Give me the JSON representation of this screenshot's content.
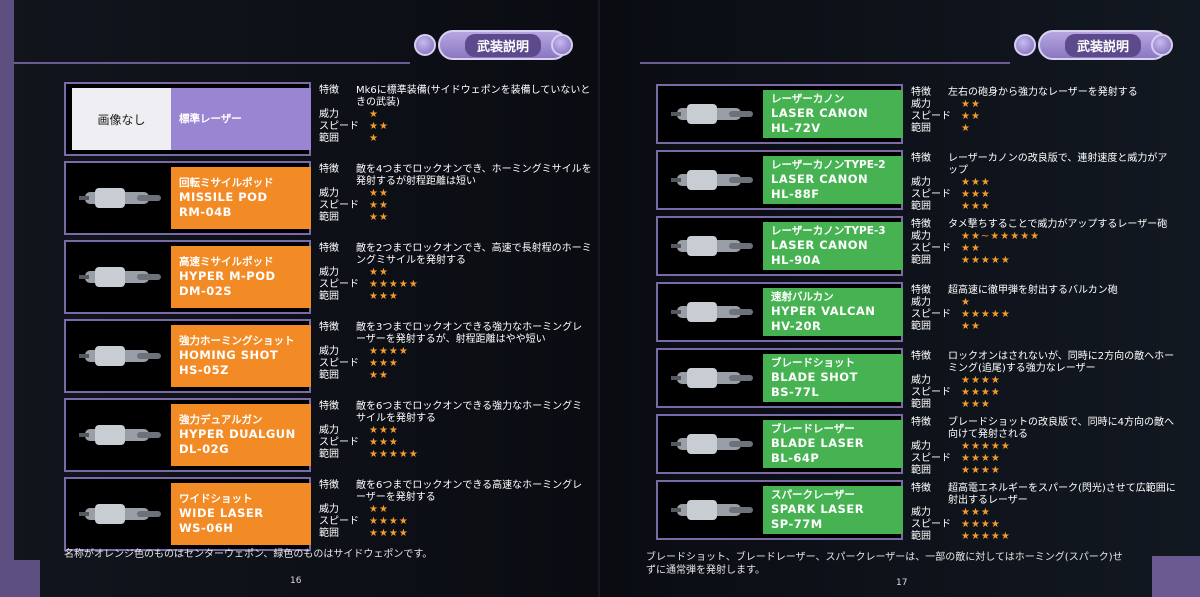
{
  "left": {
    "header": "武装説明",
    "rows": [
      {
        "image": "画像なし",
        "name_jp": "標準レーザー",
        "name_en": "",
        "code": "",
        "color": "purple",
        "feat_label": "特徴",
        "feature": "Mk6に標準装備(サイドウェポンを装備していないときの武装)",
        "stats": [
          {
            "label": "威力",
            "stars": "★"
          },
          {
            "label": "スピード",
            "stars": "★★"
          },
          {
            "label": "範囲",
            "stars": "★"
          }
        ]
      },
      {
        "image": "",
        "name_jp": "回転ミサイルポッド",
        "name_en": "MISSILE POD",
        "code": "RM-04B",
        "color": "orange",
        "feat_label": "特徴",
        "feature": "敵を4つまでロックオンでき、ホーミングミサイルを発射するが射程距離は短い",
        "stats": [
          {
            "label": "威力",
            "stars": "★★"
          },
          {
            "label": "スピード",
            "stars": "★★"
          },
          {
            "label": "範囲",
            "stars": "★★"
          }
        ]
      },
      {
        "image": "",
        "name_jp": "高速ミサイルポッド",
        "name_en": "HYPER M-POD",
        "code": "DM-02S",
        "color": "orange",
        "feat_label": "特徴",
        "feature": "敵を2つまでロックオンでき、高速で長射程のホーミングミサイルを発射する",
        "stats": [
          {
            "label": "威力",
            "stars": "★★"
          },
          {
            "label": "スピード",
            "stars": "★★★★★"
          },
          {
            "label": "範囲",
            "stars": "★★★"
          }
        ]
      },
      {
        "image": "",
        "name_jp": "強力ホーミングショット",
        "name_en": "HOMING SHOT",
        "code": "HS-05Z",
        "color": "orange",
        "feat_label": "特徴",
        "feature": "敵を3つまでロックオンできる強力なホーミングレーザーを発射するが、射程距離はやや短い",
        "stats": [
          {
            "label": "威力",
            "stars": "★★★★"
          },
          {
            "label": "スピード",
            "stars": "★★★"
          },
          {
            "label": "範囲",
            "stars": "★★"
          }
        ]
      },
      {
        "image": "",
        "name_jp": "強力デュアルガン",
        "name_en": "HYPER DUALGUN",
        "code": "DL-02G",
        "color": "orange",
        "feat_label": "特徴",
        "feature": "敵を6つまでロックオンできる強力なホーミングミサイルを発射する",
        "stats": [
          {
            "label": "威力",
            "stars": "★★★"
          },
          {
            "label": "スピード",
            "stars": "★★★"
          },
          {
            "label": "範囲",
            "stars": "★★★★★"
          }
        ]
      },
      {
        "image": "",
        "name_jp": "ワイドショット",
        "name_en": "WIDE LASER",
        "code": "WS-06H",
        "color": "orange",
        "feat_label": "特徴",
        "feature": "敵を6つまでロックオンできる高速なホーミングレーザーを発射する",
        "stats": [
          {
            "label": "威力",
            "stars": "★★"
          },
          {
            "label": "スピード",
            "stars": "★★★★"
          },
          {
            "label": "範囲",
            "stars": "★★★★"
          }
        ]
      }
    ],
    "footer": "名称がオレンジ色のものはセンターウェポン、緑色のものはサイドウェポンです。",
    "page_number": "16"
  },
  "right": {
    "header": "武装説明",
    "rows": [
      {
        "name_jp": "レーザーカノン",
        "name_en": "LASER CANON",
        "code": "HL-72V",
        "color": "green",
        "feat_label": "特徴",
        "feature": "左右の砲身から強力なレーザーを発射する",
        "stats": [
          {
            "label": "威力",
            "stars": "★★"
          },
          {
            "label": "スピード",
            "stars": "★★"
          },
          {
            "label": "範囲",
            "stars": "★"
          }
        ]
      },
      {
        "name_jp": "レーザーカノンTYPE-2",
        "name_en": "LASER CANON",
        "code": "HL-88F",
        "color": "green",
        "feat_label": "特徴",
        "feature": "レーザーカノンの改良版で、連射速度と威力がアップ",
        "stats": [
          {
            "label": "威力",
            "stars": "★★★"
          },
          {
            "label": "スピード",
            "stars": "★★★"
          },
          {
            "label": "範囲",
            "stars": "★★★"
          }
        ]
      },
      {
        "name_jp": "レーザーカノンTYPE-3",
        "name_en": "LASER CANON",
        "code": "HL-90A",
        "color": "green",
        "feat_label": "特徴",
        "feature": "タメ撃ちすることで威力がアップするレーザー砲",
        "stats": [
          {
            "label": "威力",
            "stars": "★★~★★★★★"
          },
          {
            "label": "スピード",
            "stars": "★★"
          },
          {
            "label": "範囲",
            "stars": "★★★★★"
          }
        ]
      },
      {
        "name_jp": "速射バルカン",
        "name_en": "HYPER VALCAN",
        "code": "HV-20R",
        "color": "green",
        "feat_label": "特徴",
        "feature": "超高速に徹甲弾を射出するバルカン砲",
        "stats": [
          {
            "label": "威力",
            "stars": "★"
          },
          {
            "label": "スピード",
            "stars": "★★★★★"
          },
          {
            "label": "範囲",
            "stars": "★★"
          }
        ]
      },
      {
        "name_jp": "ブレードショット",
        "name_en": "BLADE SHOT",
        "code": "BS-77L",
        "color": "green",
        "feat_label": "特徴",
        "feature": "ロックオンはされないが、同時に2方向の敵へホーミング(追尾)する強力なレーザー",
        "stats": [
          {
            "label": "威力",
            "stars": "★★★★"
          },
          {
            "label": "スピード",
            "stars": "★★★★"
          },
          {
            "label": "範囲",
            "stars": "★★★"
          }
        ]
      },
      {
        "name_jp": "ブレードレーザー",
        "name_en": "BLADE LASER",
        "code": "BL-64P",
        "color": "green",
        "feat_label": "特徴",
        "feature": "ブレードショットの改良版で、同時に4方向の敵へ向けて発射される",
        "stats": [
          {
            "label": "威力",
            "stars": "★★★★★"
          },
          {
            "label": "スピード",
            "stars": "★★★★"
          },
          {
            "label": "範囲",
            "stars": "★★★★"
          }
        ]
      },
      {
        "name_jp": "スパークレーザー",
        "name_en": "SPARK LASER",
        "code": "SP-77M",
        "color": "green",
        "feat_label": "特徴",
        "feature": "超高電エネルギーをスパーク(閃光)させて広範囲に射出するレーザー",
        "stats": [
          {
            "label": "威力",
            "stars": "★★★"
          },
          {
            "label": "スピード",
            "stars": "★★★★"
          },
          {
            "label": "範囲",
            "stars": "★★★★★"
          }
        ]
      }
    ],
    "footer": "ブレードショット、ブレードレーザー、スパークレーザーは、一部の敵に対してはホーミング(スパーク)せずに通常弾を発射します。",
    "page_number": "17"
  }
}
